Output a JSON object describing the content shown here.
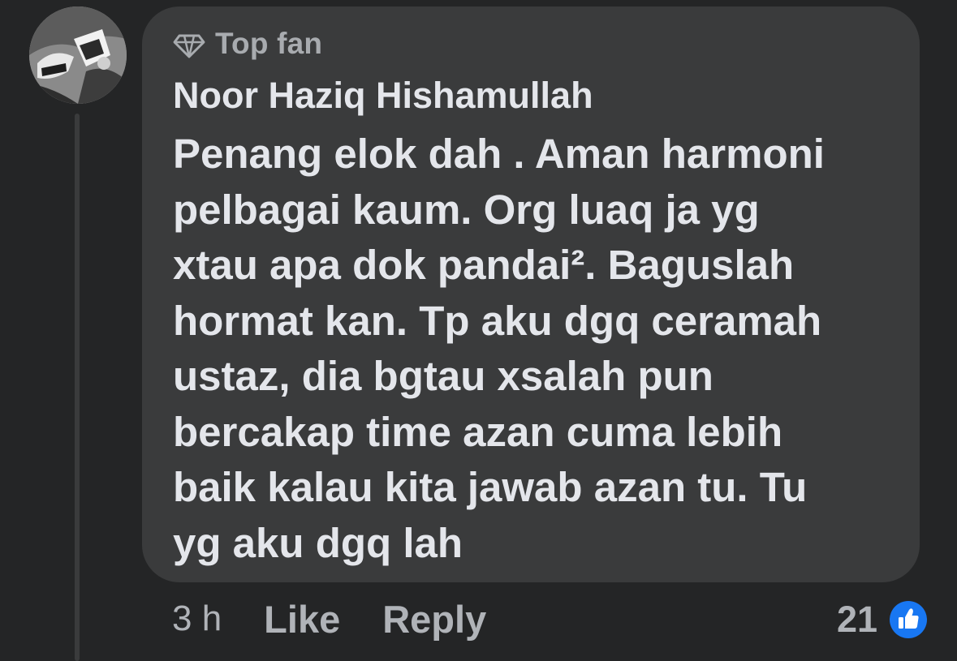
{
  "badge": {
    "icon": "diamond-icon",
    "label": "Top fan"
  },
  "comment": {
    "author": "Noor Haziq Hishamullah",
    "lines": [
      "Penang elok dah . Aman harmoni",
      "pelbagai kaum. Org luaq ja yg",
      "xtau apa dok pandai². Baguslah",
      "hormat kan. Tp aku dgq ceramah",
      "ustaz, dia bgtau xsalah pun",
      "bercakap time azan cuma lebih",
      "baik kalau kita jawab azan tu. Tu",
      "yg aku dgq lah"
    ]
  },
  "actions": {
    "time": "3 h",
    "like_label": "Like",
    "reply_label": "Reply"
  },
  "reactions": {
    "count": "21",
    "icon": "thumbs-up-icon",
    "icon_color": "#1877f2"
  },
  "colors": {
    "background": "#242526",
    "bubble": "#3a3b3c",
    "text_primary": "#e4e6eb",
    "text_secondary": "#b0b3b8"
  }
}
